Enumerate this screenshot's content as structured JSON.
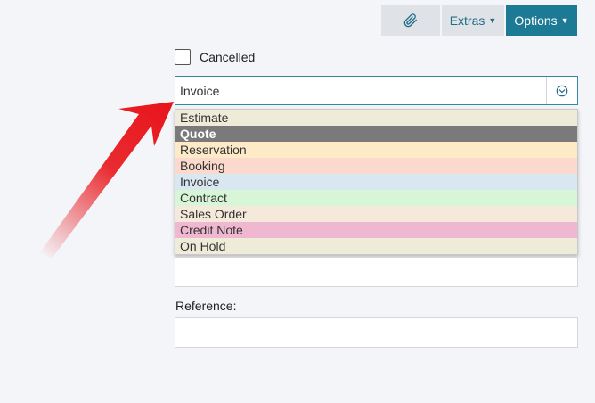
{
  "toolbar": {
    "attach_icon": "paperclip-icon",
    "extras_label": "Extras",
    "options_label": "Options",
    "accent_color": "#1d7a95"
  },
  "cancelled": {
    "label": "Cancelled",
    "checked": false
  },
  "doc_type": {
    "value": "Invoice",
    "toggle_icon": "chevron-down-circle-icon",
    "options": [
      {
        "label": "Estimate",
        "color": "#efebd9"
      },
      {
        "label": "Quote",
        "color": "#7a7a7a",
        "selected": true
      },
      {
        "label": "Reservation",
        "color": "#fdebc8"
      },
      {
        "label": "Booking",
        "color": "#fbd9cc"
      },
      {
        "label": "Invoice",
        "color": "#d9e7f1"
      },
      {
        "label": "Contract",
        "color": "#d7f5d7"
      },
      {
        "label": "Sales Order",
        "color": "#f4e9da"
      },
      {
        "label": "Credit Note",
        "color": "#f0b7d1"
      },
      {
        "label": "On Hold",
        "color": "#efebd9"
      }
    ]
  },
  "reference": {
    "label": "Reference:",
    "value": ""
  },
  "annotation": {
    "arrow_color": "#e8141a"
  }
}
